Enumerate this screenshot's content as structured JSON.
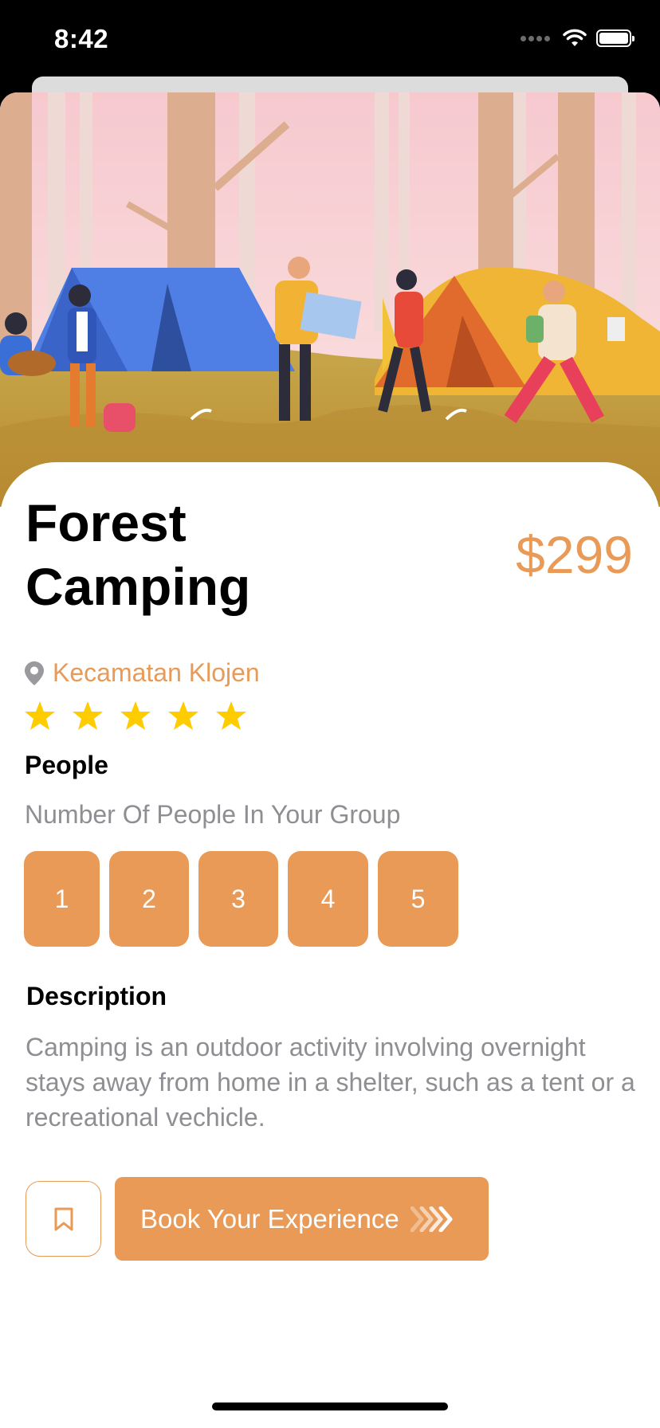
{
  "status_bar": {
    "time": "8:42"
  },
  "trip": {
    "title": "Forest Camping",
    "price": "$299",
    "location": "Kecamatan Klojen",
    "rating": 5,
    "rating_max": 5
  },
  "people": {
    "title": "People",
    "subtitle": "Number Of People In Your Group",
    "options": [
      "1",
      "2",
      "3",
      "4",
      "5"
    ]
  },
  "description": {
    "title": "Description",
    "text": "Camping is an outdoor activity involving overnight stays away from home in a shelter, such as a tent or a recreational vechicle."
  },
  "actions": {
    "book_label": "Book Your Experience",
    "bookmark_icon": "bookmark-icon",
    "arrow_icon": "chevrons-right-icon"
  },
  "colors": {
    "accent": "#e99a57",
    "star": "#ffcc00",
    "muted_text": "#8e8e93"
  }
}
